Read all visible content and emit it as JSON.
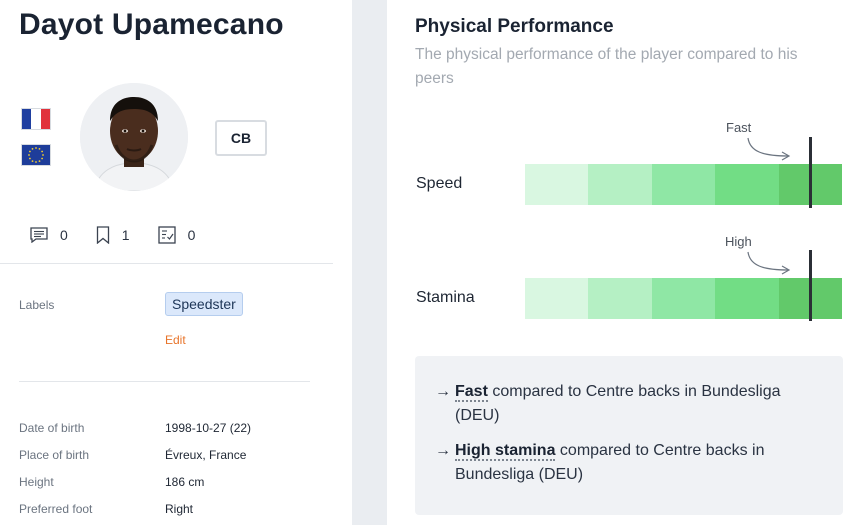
{
  "player": {
    "name": "Dayot Upamecano",
    "position": "CB"
  },
  "flags": [
    {
      "name": "france-flag",
      "colors": [
        "#1f3fa0",
        "#ffffff",
        "#e1323c"
      ]
    },
    {
      "name": "eu-flag",
      "color": "#1e3d9a",
      "star_color": "#f5cf2e"
    }
  ],
  "counts": {
    "comments": "0",
    "bookmarks": "1",
    "reports": "0"
  },
  "labels": {
    "label": "Labels",
    "chip": "Speedster",
    "edit": "Edit"
  },
  "details": [
    {
      "label": "Date of birth",
      "value": "1998-10-27 (22)"
    },
    {
      "label": "Place of birth",
      "value": "Évreux, France"
    },
    {
      "label": "Height",
      "value": "186 cm"
    },
    {
      "label": "Preferred foot",
      "value": "Right"
    }
  ],
  "physical": {
    "title": "Physical Performance",
    "subtitle": "The physical performance of the player compared to his peers",
    "scale_colors": [
      "#d9f7e1",
      "#b5f0c4",
      "#8fe7a5",
      "#72dd85",
      "#62c96a"
    ],
    "metrics": [
      {
        "label": "Speed",
        "tier": "Fast",
        "percentile": 0.9
      },
      {
        "label": "Stamina",
        "tier": "High",
        "percentile": 0.9
      }
    ]
  },
  "summary": [
    {
      "arrow": "→",
      "highlight": "Fast",
      "rest": " compared to Centre backs in Bundesliga (DEU)"
    },
    {
      "arrow": "→",
      "highlight": "High stamina",
      "rest": " compared to Centre backs in Bundesliga (DEU)"
    }
  ]
}
